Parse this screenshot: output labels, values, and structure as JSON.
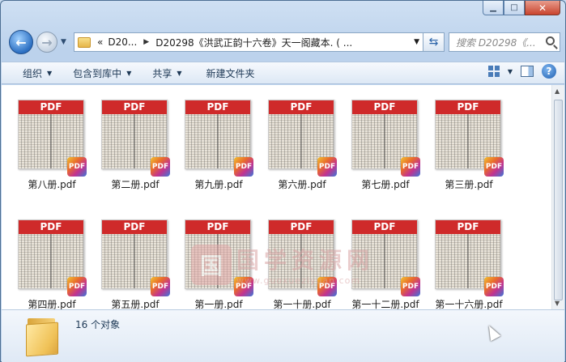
{
  "window": {
    "caption_buttons": [
      "minimize",
      "maximize",
      "close"
    ]
  },
  "nav": {
    "breadcrumb": [
      "D20...",
      "D20298《洪武正韵十六卷》天一阁藏本. ( ..."
    ],
    "breadcrumb_prefix": "«",
    "search_placeholder": "搜索 D20298《..."
  },
  "commands": {
    "organize": "组织",
    "include_in_library": "包含到库中",
    "share": "共享",
    "new_folder": "新建文件夹"
  },
  "files": [
    {
      "name": "第八册.pdf",
      "band": "PDF"
    },
    {
      "name": "第二册.pdf",
      "band": "PDF"
    },
    {
      "name": "第九册.pdf",
      "band": "PDF"
    },
    {
      "name": "第六册.pdf",
      "band": "PDF"
    },
    {
      "name": "第七册.pdf",
      "band": "PDF"
    },
    {
      "name": "第三册.pdf",
      "band": "PDF"
    },
    {
      "name": "第四册.pdf",
      "band": "PDF"
    },
    {
      "name": "第五册.pdf",
      "band": "PDF"
    },
    {
      "name": "第一册.pdf",
      "band": "PDF"
    },
    {
      "name": "第一十册.pdf",
      "band": "PDF"
    },
    {
      "name": "第一十二册.pdf",
      "band": "PDF"
    },
    {
      "name": "第一十六册.pdf",
      "band": "PDF"
    }
  ],
  "badge_label": "PDF",
  "watermark": {
    "logo": "国",
    "title": "国学资源网",
    "url": "www.guoxueziyuan.com"
  },
  "status": {
    "count": "16 个对象"
  },
  "colors": {
    "pdf_band": "#cf2a2a",
    "window_frame": "#bcd2ec"
  }
}
